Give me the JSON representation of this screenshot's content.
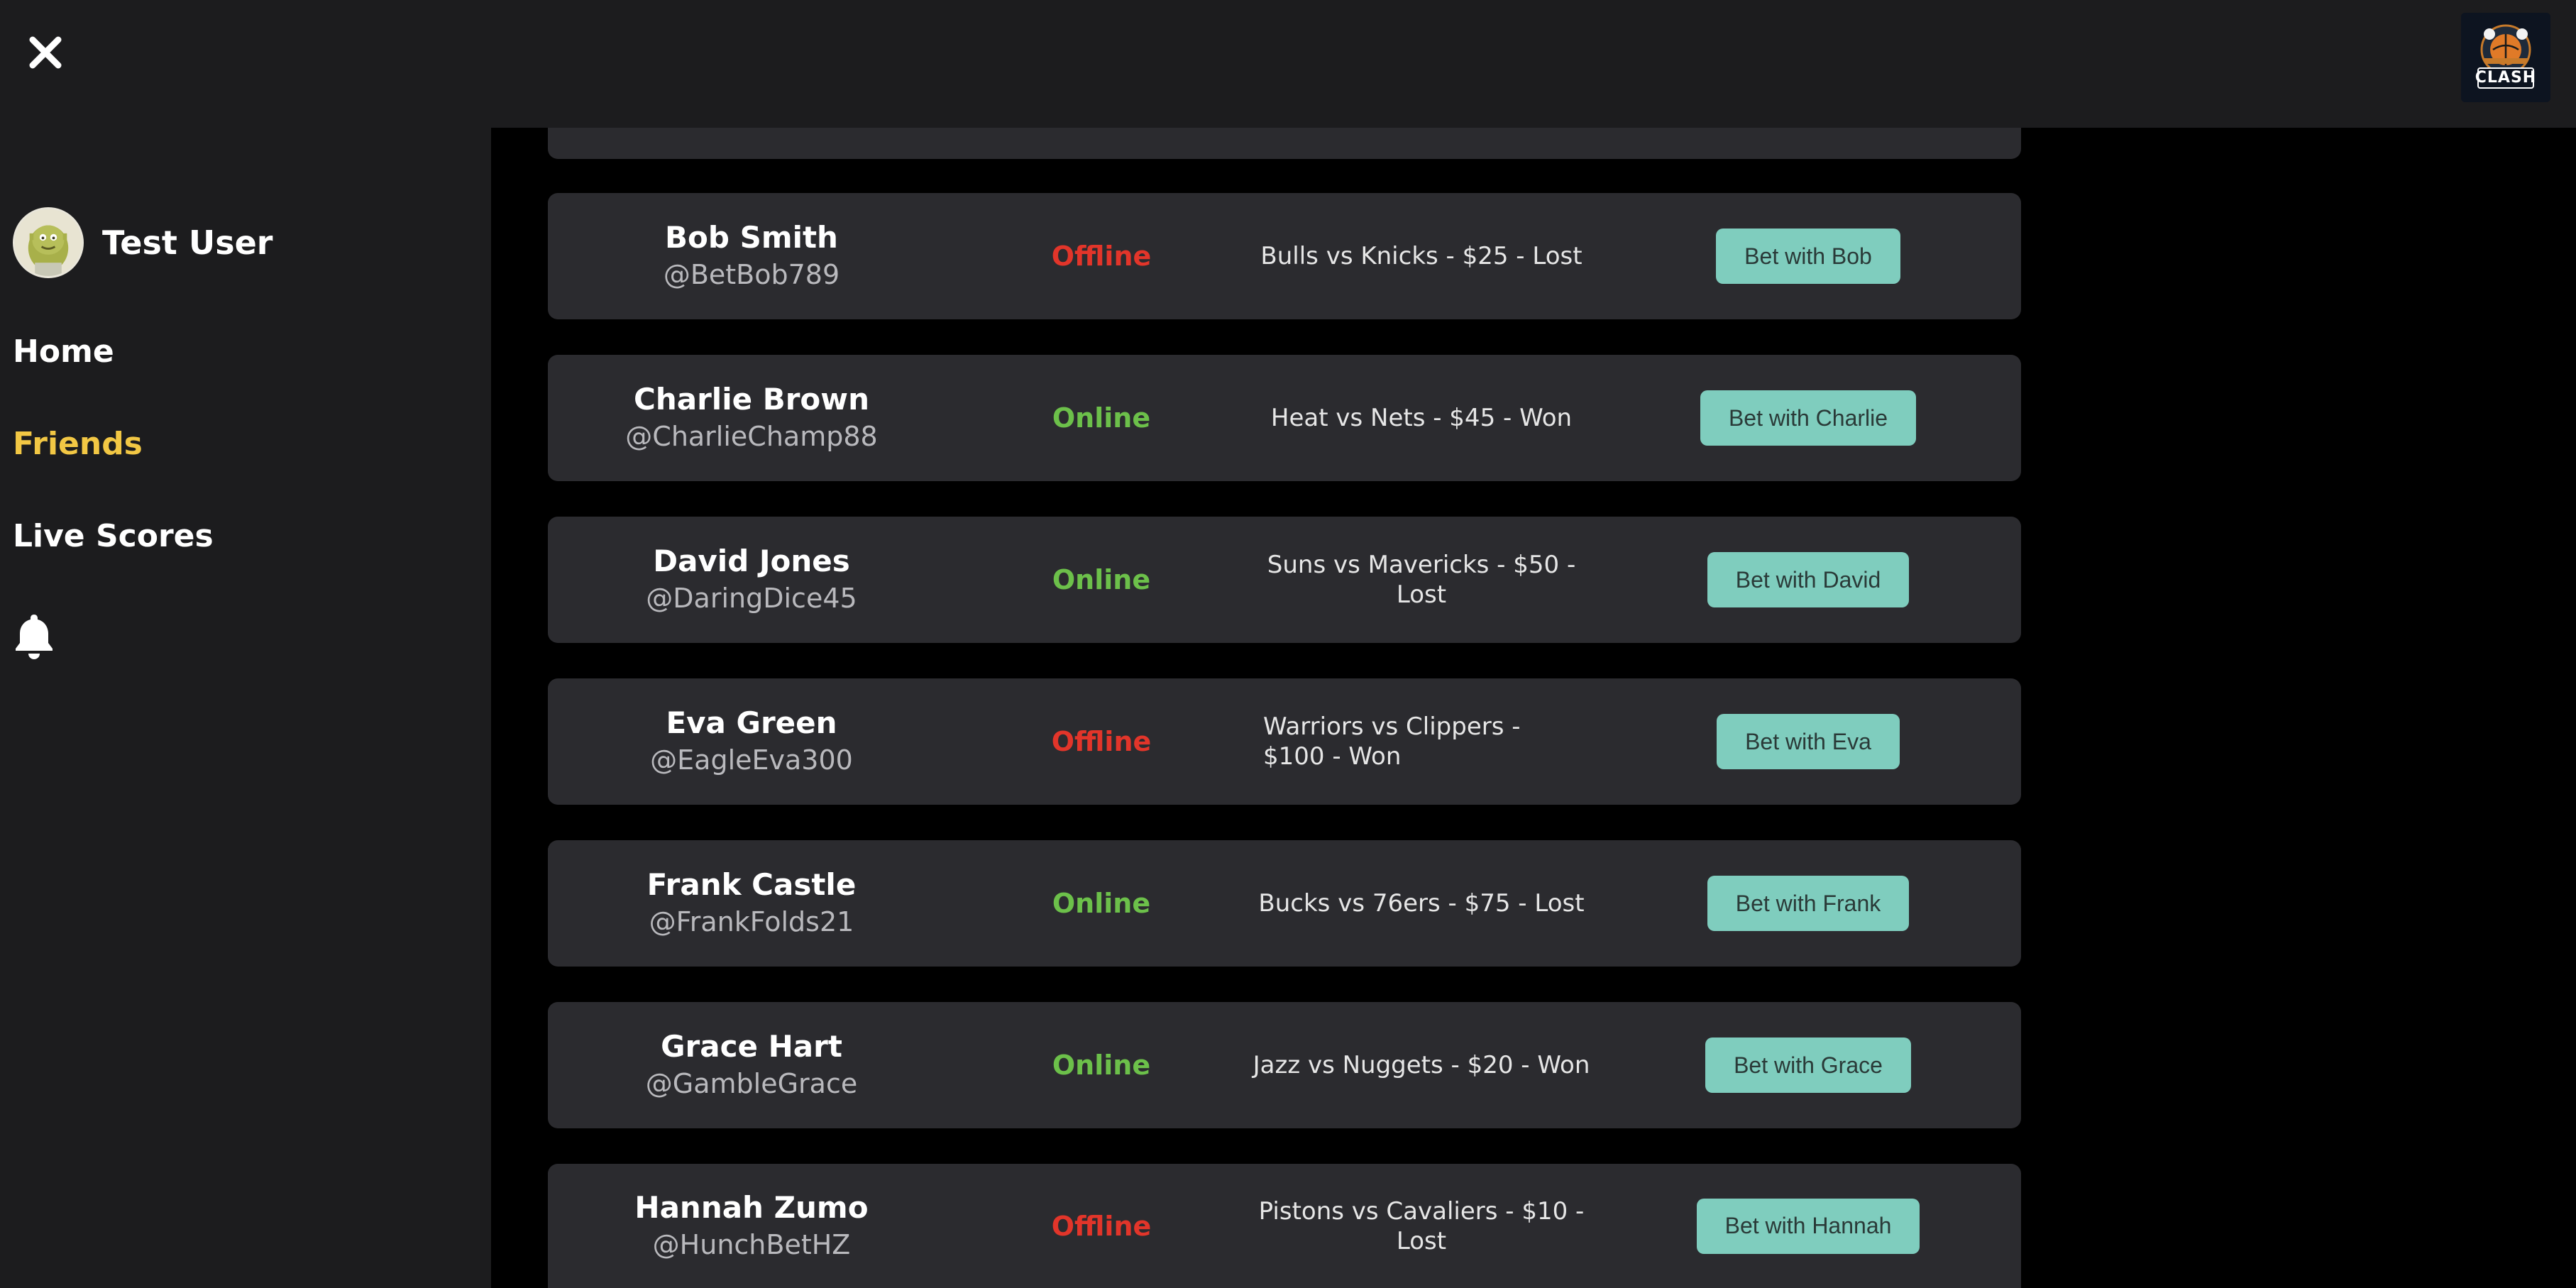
{
  "sidebar": {
    "user_name": "Test User",
    "nav": [
      {
        "label": "Home",
        "active": false
      },
      {
        "label": "Friends",
        "active": true
      },
      {
        "label": "Live Scores",
        "active": false
      }
    ],
    "notification_icon": "bell-icon"
  },
  "header": {
    "close_icon": "close-icon",
    "logo_text": "CLASH"
  },
  "colors": {
    "background": "#000000",
    "panel": "#1c1c1e",
    "row": "#2b2b2f",
    "active_nav": "#f2c744",
    "online": "#6cc04a",
    "offline": "#e2352a",
    "button": "#7fcdbe"
  },
  "friends": [
    {
      "name": "Bob Smith",
      "handle": "@BetBob789",
      "status": "Offline",
      "last_bet": "Bulls vs Knicks - $25 - Lost",
      "button": "Bet with Bob"
    },
    {
      "name": "Charlie Brown",
      "handle": "@CharlieChamp88",
      "status": "Online",
      "last_bet": "Heat vs Nets - $45 - Won",
      "button": "Bet with Charlie"
    },
    {
      "name": "David Jones",
      "handle": "@DaringDice45",
      "status": "Online",
      "last_bet": "Suns vs Mavericks - $50 - Lost",
      "button": "Bet with David"
    },
    {
      "name": "Eva Green",
      "handle": "@EagleEva300",
      "status": "Offline",
      "last_bet": "Warriors vs Clippers - $100 - Won",
      "button": "Bet with Eva"
    },
    {
      "name": "Frank Castle",
      "handle": "@FrankFolds21",
      "status": "Online",
      "last_bet": "Bucks vs 76ers - $75 - Lost",
      "button": "Bet with Frank"
    },
    {
      "name": "Grace Hart",
      "handle": "@GambleGrace",
      "status": "Online",
      "last_bet": "Jazz vs Nuggets - $20 - Won",
      "button": "Bet with Grace"
    },
    {
      "name": "Hannah Zumo",
      "handle": "@HunchBetHZ",
      "status": "Offline",
      "last_bet": "Pistons vs Cavaliers - $10 - Lost",
      "button": "Bet with Hannah"
    }
  ]
}
